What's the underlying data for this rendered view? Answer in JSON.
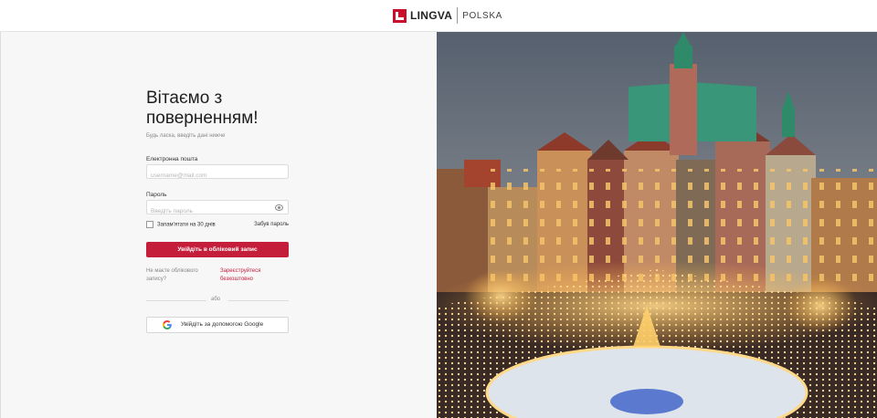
{
  "header": {
    "brand": "LINGVA",
    "brand_sub": "POLSKA"
  },
  "login": {
    "title_line1": "Вітаємо з",
    "title_line2": "поверненням!",
    "subtitle": "Будь ласка, введіть дані нижче",
    "email_label": "Електронна пошта",
    "email_placeholder": "username@mail.com",
    "password_label": "Пароль",
    "password_placeholder": "Введіть пароль",
    "remember_label": "Запам'ятати на 30 днів",
    "forgot_label": "Забув пароль",
    "submit_label": "Увійдіть в обліковий запис",
    "no_account_text": "Не маєте облікового запису?",
    "register_label": "Зареєструйтеся безкоштовно",
    "or_text": "або",
    "google_label": "Увійдіть за допомогою Google"
  },
  "colors": {
    "accent": "#c41e3a",
    "logo": "#c8102e"
  },
  "icons": [
    "lingva-logo-icon",
    "eye-icon",
    "checkbox-icon",
    "google-icon"
  ]
}
